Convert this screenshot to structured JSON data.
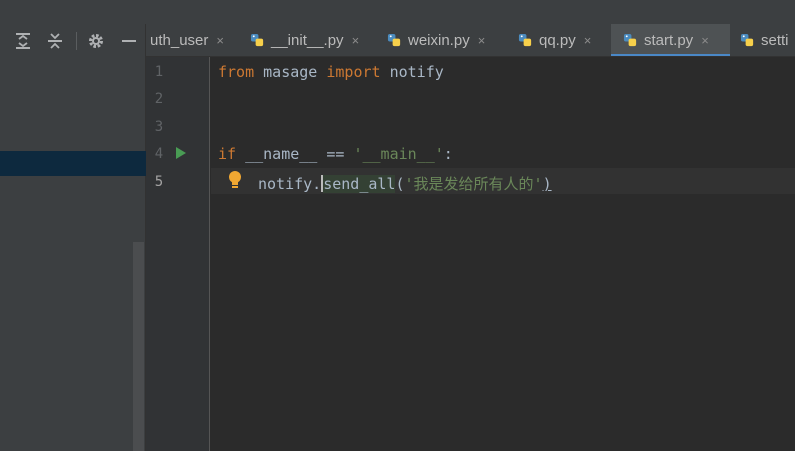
{
  "tabs": [
    {
      "label": "uth_user",
      "has_icon": false,
      "active": false
    },
    {
      "label": "__init__.py",
      "has_icon": true,
      "active": false
    },
    {
      "label": "weixin.py",
      "has_icon": true,
      "active": false
    },
    {
      "label": "qq.py",
      "has_icon": true,
      "active": false
    },
    {
      "label": "start.py",
      "has_icon": true,
      "active": true
    },
    {
      "label": "setti",
      "has_icon": true,
      "active": false
    }
  ],
  "close_glyph": "×",
  "toolbar_icons": [
    "expand-all-icon",
    "collapse-all-icon",
    "gear-icon",
    "minimize-icon"
  ],
  "editor": {
    "line_numbers": [
      "1",
      "2",
      "3",
      "4",
      "5"
    ],
    "current_line": "5",
    "line1": {
      "kw1": "from",
      "mod": " masage ",
      "kw2": "import",
      "name": " notify"
    },
    "line4": {
      "kw": "if",
      "name": " __name__ == ",
      "str": "'__main__'",
      "colon": ":"
    },
    "line5": {
      "obj": "notify.",
      "method": "send_all",
      "open": "(",
      "str": "'我是发给所有人的'",
      "close": ")"
    }
  },
  "colors": {
    "keyword": "#cc7832",
    "string": "#6a8759",
    "text": "#a9b7c6",
    "run_arrow": "#499c54",
    "bulb": "#f0a732",
    "tab_underline": "#4a88c7"
  }
}
